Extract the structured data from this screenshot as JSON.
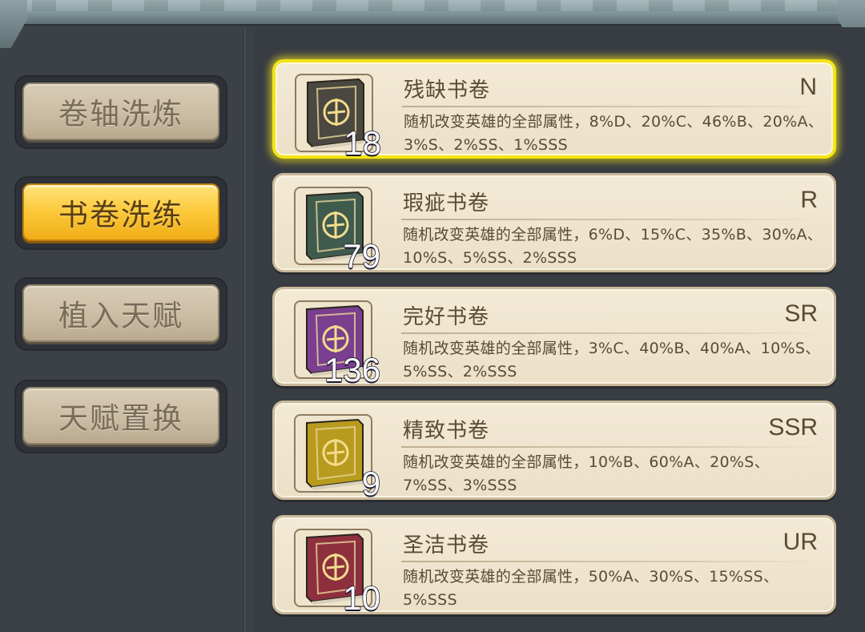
{
  "sidebar": {
    "tabs": [
      {
        "label": "卷轴洗炼",
        "active": false
      },
      {
        "label": "书卷洗练",
        "active": true
      },
      {
        "label": "植入天赋",
        "active": false
      },
      {
        "label": "天赋置换",
        "active": false
      }
    ]
  },
  "books": [
    {
      "title": "残缺书卷",
      "rarity": "N",
      "count": "18",
      "desc": "随机改变英雄的全部属性，8%D、20%C、46%B、20%A、3%S、2%SS、1%SSS",
      "color": "#4a4840",
      "selected": true
    },
    {
      "title": "瑕疵书卷",
      "rarity": "R",
      "count": "79",
      "desc": "随机改变英雄的全部属性，6%D、15%C、35%B、30%A、10%S、5%SS、2%SSS",
      "color": "#3f5b4e",
      "selected": false
    },
    {
      "title": "完好书卷",
      "rarity": "SR",
      "count": "136",
      "desc": "随机改变英雄的全部属性，3%C、40%B、40%A、10%S、5%SS、2%SSS",
      "color": "#7a3f8e",
      "selected": false
    },
    {
      "title": "精致书卷",
      "rarity": "SSR",
      "count": "9",
      "desc": "随机改变英雄的全部属性，10%B、60%A、20%S、7%SS、3%SSS",
      "color": "#b89a1e",
      "selected": false
    },
    {
      "title": "圣洁书卷",
      "rarity": "UR",
      "count": "10",
      "desc": "随机改变英雄的全部属性，50%A、30%S、15%SS、5%SSS",
      "color": "#8e2f3e",
      "selected": false
    }
  ]
}
